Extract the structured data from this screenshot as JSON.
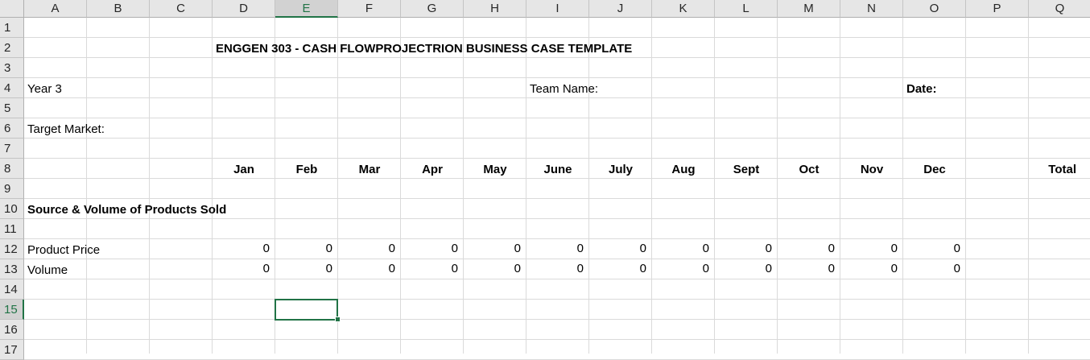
{
  "columns": [
    "A",
    "B",
    "C",
    "D",
    "E",
    "F",
    "G",
    "H",
    "I",
    "J",
    "K",
    "L",
    "M",
    "N",
    "O",
    "P",
    "Q"
  ],
  "rows": [
    "1",
    "2",
    "3",
    "4",
    "5",
    "6",
    "7",
    "8",
    "9",
    "10",
    "11",
    "12",
    "13",
    "14",
    "15",
    "16",
    "17"
  ],
  "selected_cell": "E15",
  "accent_color": "#217346",
  "cells": {
    "title": "ENGGEN 303 - CASH FLOWPROJECTRION BUSINESS CASE TEMPLATE",
    "year": "Year 3",
    "team_name_label": "Team Name:",
    "date_label": "Date:",
    "target_market_label": "Target Market:",
    "section_heading": "Source & Volume of Products Sold",
    "product_price_label": "Product Price",
    "volume_label": "Volume"
  },
  "months": [
    "Jan",
    "Feb",
    "Mar",
    "Apr",
    "May",
    "June",
    "July",
    "Aug",
    "Sept",
    "Oct",
    "Nov",
    "Dec"
  ],
  "total_label": "Total",
  "product_price_values": [
    "0",
    "0",
    "0",
    "0",
    "0",
    "0",
    "0",
    "0",
    "0",
    "0",
    "0",
    "0"
  ],
  "volume_values": [
    "0",
    "0",
    "0",
    "0",
    "0",
    "0",
    "0",
    "0",
    "0",
    "0",
    "0",
    "0"
  ]
}
